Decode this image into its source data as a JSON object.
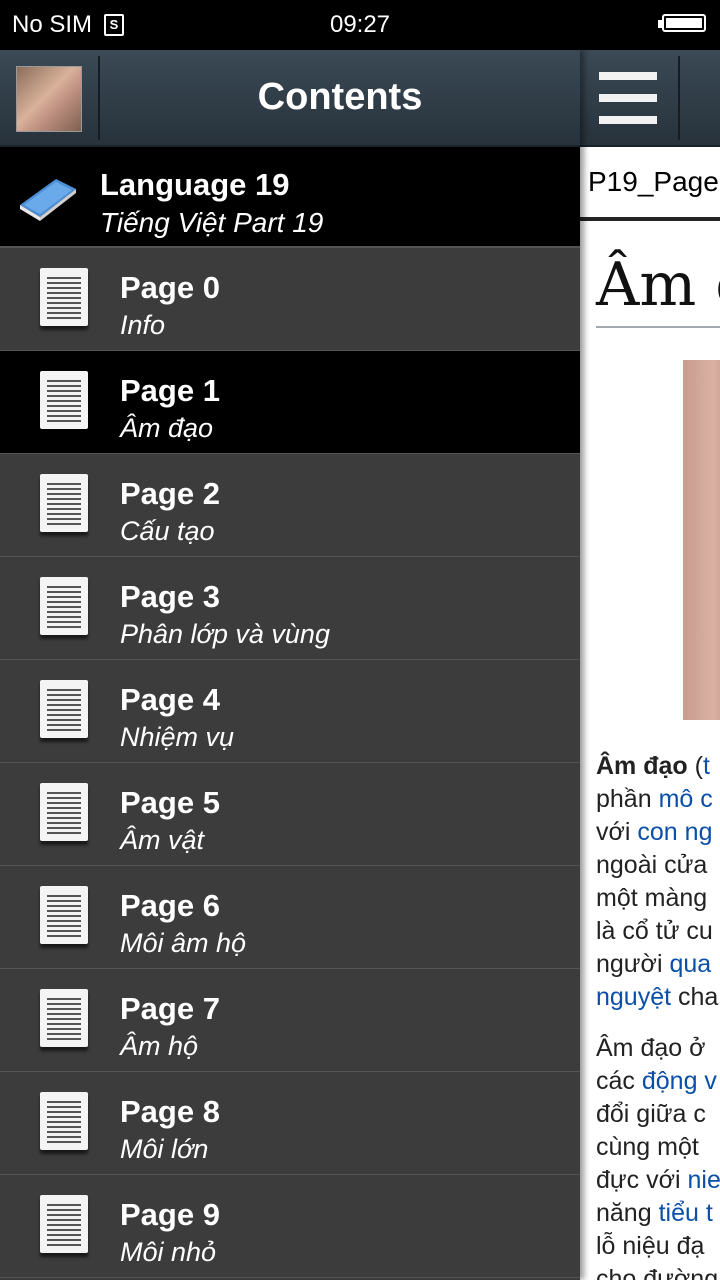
{
  "status_bar": {
    "carrier": "No SIM",
    "sim_badge": "S",
    "time": "09:27"
  },
  "drawer": {
    "title": "Contents",
    "language": {
      "title": "Language 19",
      "subtitle": "Tiếng Việt Part 19"
    },
    "items": [
      {
        "title": "Page 0",
        "subtitle": "Info"
      },
      {
        "title": "Page 1",
        "subtitle": "Âm đạo",
        "active": true
      },
      {
        "title": "Page 2",
        "subtitle": "Cấu tạo"
      },
      {
        "title": "Page 3",
        "subtitle": "Phân lớp và vùng"
      },
      {
        "title": "Page 4",
        "subtitle": "Nhiệm vụ"
      },
      {
        "title": "Page 5",
        "subtitle": "Âm vật"
      },
      {
        "title": "Page 6",
        "subtitle": "Môi âm hộ"
      },
      {
        "title": "Page 7",
        "subtitle": "Âm hộ"
      },
      {
        "title": "Page 8",
        "subtitle": "Môi lớn"
      },
      {
        "title": "Page 9",
        "subtitle": "Môi nhỏ"
      }
    ]
  },
  "content": {
    "page_name": "P19_Page",
    "article_title": "Âm đ",
    "paragraph1": [
      [
        {
          "t": "Âm đạo",
          "b": true
        },
        {
          "t": " ("
        },
        {
          "t": "t",
          "link": true
        }
      ],
      [
        {
          "t": "phần "
        },
        {
          "t": "mô c",
          "link": true
        }
      ],
      [
        {
          "t": "với "
        },
        {
          "t": "con ng",
          "link": true
        }
      ],
      [
        {
          "t": "ngoài cửa"
        }
      ],
      [
        {
          "t": "một màng"
        }
      ],
      [
        {
          "t": "là cổ tử cu"
        }
      ],
      [
        {
          "t": "người "
        },
        {
          "t": "qua",
          "link": true
        }
      ],
      [
        {
          "t": "nguyệt",
          "link": true
        },
        {
          "t": " cha"
        }
      ]
    ],
    "paragraph2": [
      [
        {
          "t": "Âm đạo ở"
        }
      ],
      [
        {
          "t": "các "
        },
        {
          "t": "động v",
          "link": true
        }
      ],
      [
        {
          "t": "đổi giữa c"
        }
      ],
      [
        {
          "t": "cùng một"
        }
      ],
      [
        {
          "t": "đực với "
        },
        {
          "t": "nie",
          "link": true
        }
      ],
      [
        {
          "t": "năng "
        },
        {
          "t": "tiểu t",
          "link": true
        }
      ],
      [
        {
          "t": "lỗ niệu đạ"
        }
      ],
      [
        {
          "t": "cho đường"
        }
      ]
    ]
  },
  "colors": {
    "toolbar": "#303c46",
    "drawer_bg": "#3c3c3c",
    "active_row": "#000000",
    "link": "#0b4fa8"
  }
}
